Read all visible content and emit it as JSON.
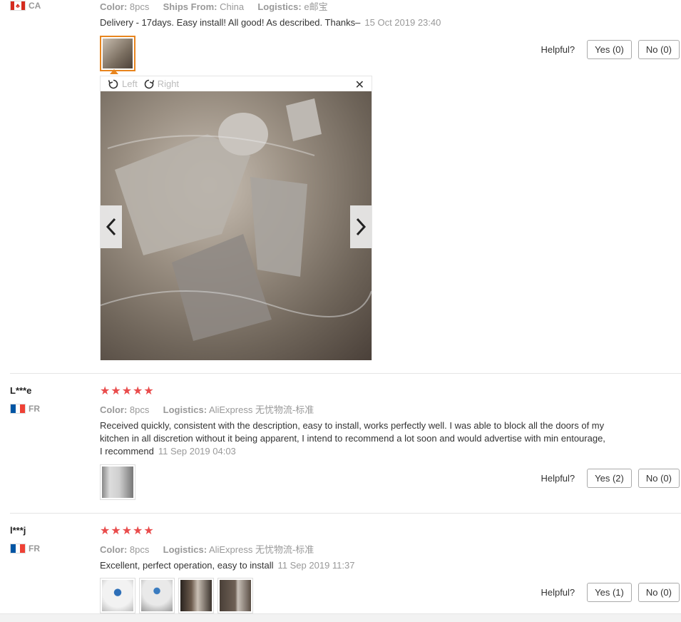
{
  "review1": {
    "country": "CA",
    "color_label": "Color:",
    "color_value": "8pcs",
    "ships_label": "Ships From:",
    "ships_value": "China",
    "logistics_label": "Logistics:",
    "logistics_value": "e邮宝",
    "text": "Delivery - 17days. Easy install! All good! As described. Thanks–",
    "date": "15 Oct 2019 23:40",
    "helpful_label": "Helpful?",
    "yes_label": "Yes (0)",
    "no_label": "No (0)",
    "viewer": {
      "rotate_left": "Left",
      "rotate_right": "Right",
      "close": "✕"
    }
  },
  "review2": {
    "user": "L***e",
    "country": "FR",
    "stars": "★★★★★",
    "color_label": "Color:",
    "color_value": "8pcs",
    "logistics_label": "Logistics:",
    "logistics_value": "AliExpress 无忧物流-标准",
    "text": "Received quickly, consistent with the description, easy to install, works perfectly well. I was able to block all the doors of my kitchen in all discretion without it being apparent, I intend to recommend a lot soon and would advertise with min entourage, I recommend",
    "date": "11 Sep 2019 04:03",
    "helpful_label": "Helpful?",
    "yes_label": "Yes (2)",
    "no_label": "No (0)"
  },
  "review3": {
    "user": "l***j",
    "country": "FR",
    "stars": "★★★★★",
    "color_label": "Color:",
    "color_value": "8pcs",
    "logistics_label": "Logistics:",
    "logistics_value": "AliExpress 无忧物流-标准",
    "text": "Excellent, perfect operation, easy to install",
    "date": "11 Sep 2019 11:37",
    "helpful_label": "Helpful?",
    "yes_label": "Yes (1)",
    "no_label": "No (0)"
  },
  "colors": {
    "star": "#e94c4c",
    "active_thumb": "#e8851e",
    "muted": "#999999"
  }
}
